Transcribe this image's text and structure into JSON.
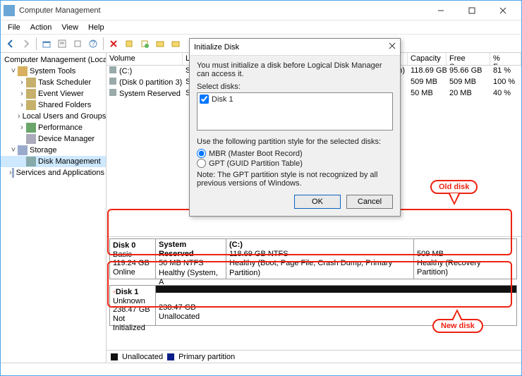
{
  "window": {
    "title": "Computer Management"
  },
  "menu": {
    "file": "File",
    "action": "Action",
    "view": "View",
    "help": "Help"
  },
  "tree": {
    "root": "Computer Management (Local",
    "systools": "System Tools",
    "task": "Task Scheduler",
    "event": "Event Viewer",
    "shared": "Shared Folders",
    "users": "Local Users and Groups",
    "perf": "Performance",
    "devmgr": "Device Manager",
    "storage": "Storage",
    "diskmgmt": "Disk Management",
    "services": "Services and Applications"
  },
  "columns": {
    "volume": "Volume",
    "layout": "Layou",
    "capacity": "Capacity",
    "free": "Free Space",
    "pct": "% Free"
  },
  "volumes": [
    {
      "name": "(C:)",
      "layout": "Simpl",
      "suffix": "tion)",
      "cap": "118.69 GB",
      "free": "95.66 GB",
      "pct": "81 %"
    },
    {
      "name": "(Disk 0 partition 3)",
      "layout": "Simpl",
      "suffix": "",
      "cap": "509 MB",
      "free": "509 MB",
      "pct": "100 %"
    },
    {
      "name": "System Reserved",
      "layout": "Simpl",
      "suffix": "",
      "cap": "50 MB",
      "free": "20 MB",
      "pct": "40 %"
    }
  ],
  "disk0": {
    "title": "Disk 0",
    "type": "Basic",
    "size": "119.24 GB",
    "status": "Online",
    "p1": {
      "name": "System Reserved",
      "line2": "50 MB NTFS",
      "line3": "Healthy (System, A"
    },
    "p2": {
      "name": "(C:)",
      "line2": "118.69 GB NTFS",
      "line3": "Healthy (Boot, Page File, Crash Dump, Primary Partition)"
    },
    "p3": {
      "name": "",
      "line2": "509 MB",
      "line3": "Healthy (Recovery Partition)"
    }
  },
  "disk1": {
    "title": "Disk 1",
    "type": "Unknown",
    "size": "238.47 GB",
    "status": "Not Initialized",
    "p1": {
      "line2": "238.47 GB",
      "line3": "Unallocated"
    }
  },
  "legend": {
    "unalloc": "Unallocated",
    "primary": "Primary partition"
  },
  "callouts": {
    "old": "Old disk",
    "new": "New disk"
  },
  "dialog": {
    "title": "Initialize Disk",
    "intro": "You must initialize a disk before Logical Disk Manager can access it.",
    "select": "Select disks:",
    "disk": "Disk 1",
    "partstyle": "Use the following partition style for the selected disks:",
    "mbr": "MBR (Master Boot Record)",
    "gpt": "GPT (GUID Partition Table)",
    "note": "Note: The GPT partition style is not recognized by all previous versions of Windows.",
    "ok": "OK",
    "cancel": "Cancel"
  }
}
